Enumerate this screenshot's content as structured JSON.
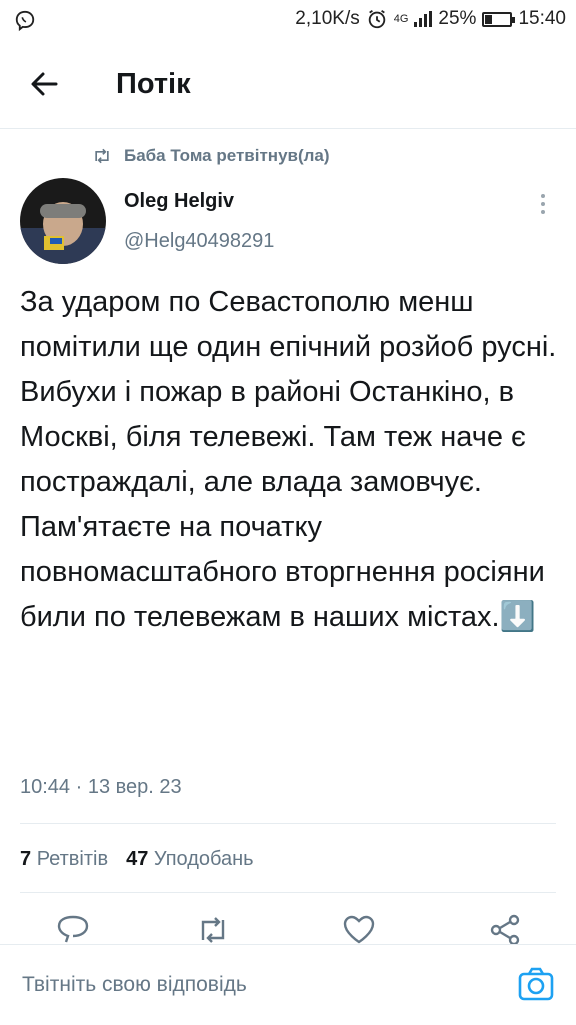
{
  "status_bar": {
    "speed": "2,10K/s",
    "network": "4G",
    "battery_percent": "25%",
    "battery_level": 0.25,
    "time": "15:40",
    "icons": [
      "viber-icon",
      "alarm-icon",
      "signal-icon",
      "battery-icon"
    ]
  },
  "app_bar": {
    "title": "Потік",
    "back_icon": "arrow-left-icon"
  },
  "tweet": {
    "retweeted_by": "Баба Тома ретвітнув(ла)",
    "author_name": "Oleg Helgiv",
    "author_handle": "@Helg40498291",
    "text_p1": "За ударом по Севастополю менш помітили ще один епічний розйоб русні. Вибухи і пожар в районі Останкіно, в Москві, біля телевежі. Там теж наче є постраждалі, але влада замовчує.",
    "text_p2": "Пам'ятаєте на початку повномасштабного вторгнення росіяни били по телевежам в наших містах.⬇️",
    "timestamp": "10:44 · 13 вер. 23",
    "retweets_count": "7",
    "retweets_label": "Ретвітів",
    "likes_count": "47",
    "likes_label": "Уподобань"
  },
  "actions": [
    "reply-icon",
    "retweet-icon",
    "like-icon",
    "share-icon"
  ],
  "reply_bar": {
    "placeholder": "Твітніть свою відповідь",
    "camera_icon": "camera-icon"
  },
  "colors": {
    "accent": "#1da1f2",
    "secondary_text": "#657786",
    "divider": "#e6ecf0"
  }
}
